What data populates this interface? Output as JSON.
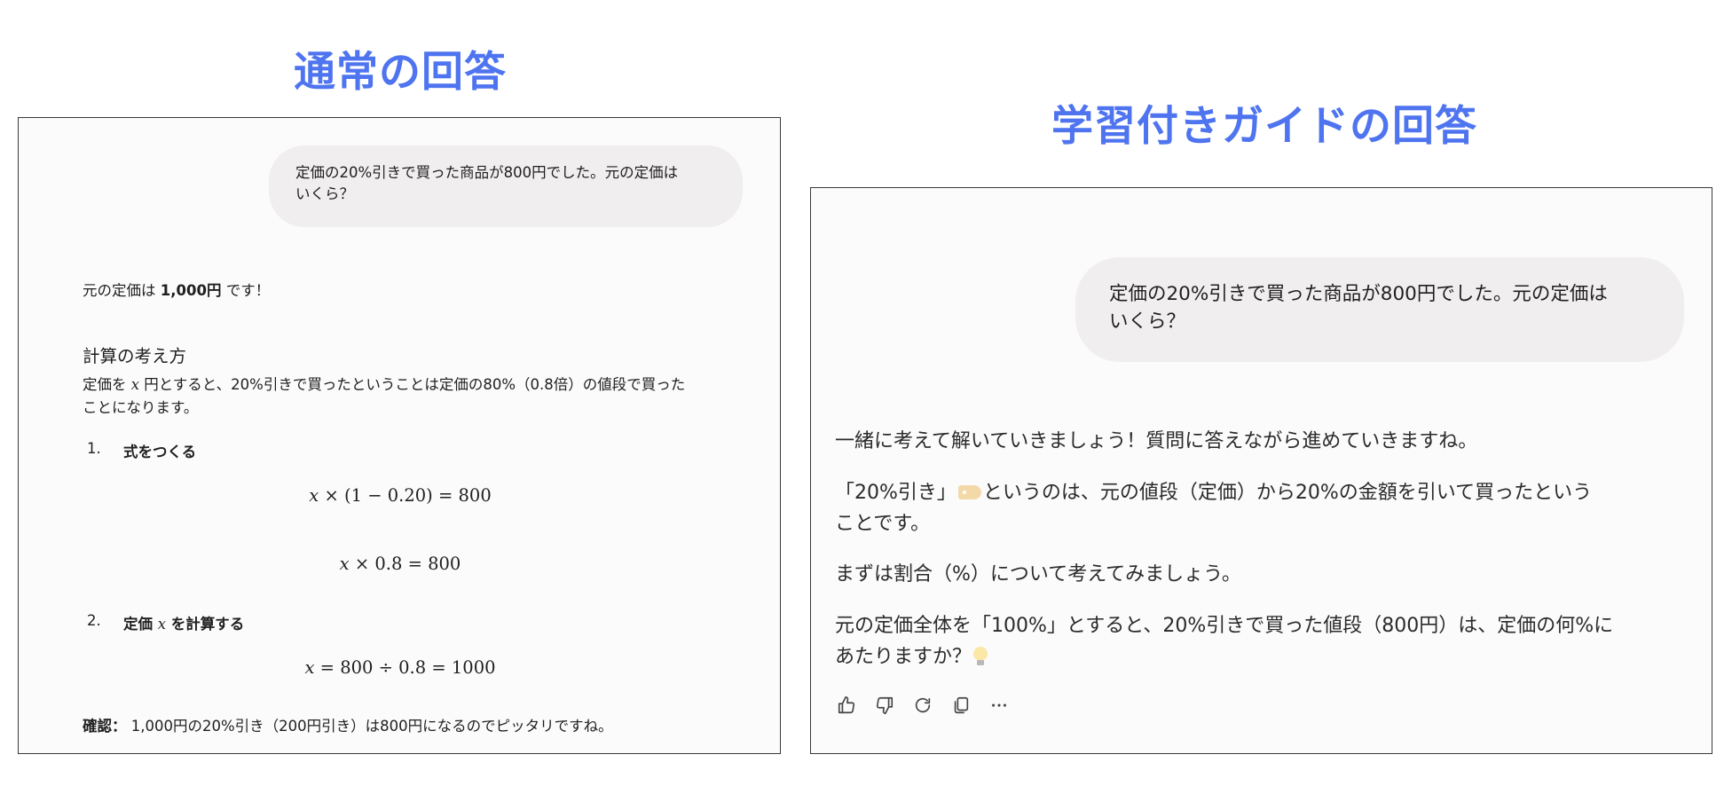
{
  "headings": {
    "normal": "通常の回答",
    "guided": "学習付きガイドの回答"
  },
  "normal_answer": {
    "user_message_line1": "定価の20%引きで買った商品が800円でした。元の定価は",
    "user_message_line2": "いくら？",
    "answer_prefix": "元の定価は ",
    "answer_bold": "1,000円",
    "answer_suffix": " です！",
    "section_title": "計算の考え方",
    "explain_pre": "定価を ",
    "explain_var": "x",
    "explain_post": " 円とすると、20%引きで買ったということは定価の80%（0.8倍）の値段で買った",
    "explain_line2": "ことになります。",
    "steps": [
      {
        "num": "1.",
        "title_pre": "式をつくる",
        "title_var": "",
        "title_post": ""
      },
      {
        "num": "2.",
        "title_pre": "定価 ",
        "title_var": "x",
        "title_post": " を計算する"
      }
    ],
    "equations": {
      "eq1_rest": " × (1 − 0.20) = 800",
      "eq2_rest": " × 0.8 = 800",
      "eq3_rest": " = 800 ÷ 0.8 = 1000",
      "var": "x"
    },
    "confirm_label": "確認：",
    "confirm_text": " 1,000円の20%引き（200円引き）は800円になるのでピッタリですね。"
  },
  "guided_answer": {
    "user_message_line1": "定価の20%引きで買った商品が800円でした。元の定価は",
    "user_message_line2": "いくら？",
    "p1": "一緒に考えて解いていきましょう！質問に答えながら進めていきますね。",
    "p2_pre": "「20%引き」",
    "p2_post": "というのは、元の値段（定価）から20%の金額を引いて買ったという",
    "p2_line2": "ことです。",
    "p3": "まずは割合（%）について考えてみましょう。",
    "p4_line1": "元の定価全体を「100%」とすると、20%引きで買った値段（800円）は、定価の何%に",
    "p4_line2": "あたりますか？",
    "icons": [
      "price-tag-emoji",
      "light-bulb-emoji"
    ],
    "actions": [
      "thumbs-up-icon",
      "thumbs-down-icon",
      "regenerate-icon",
      "copy-icon",
      "more-icon"
    ]
  }
}
